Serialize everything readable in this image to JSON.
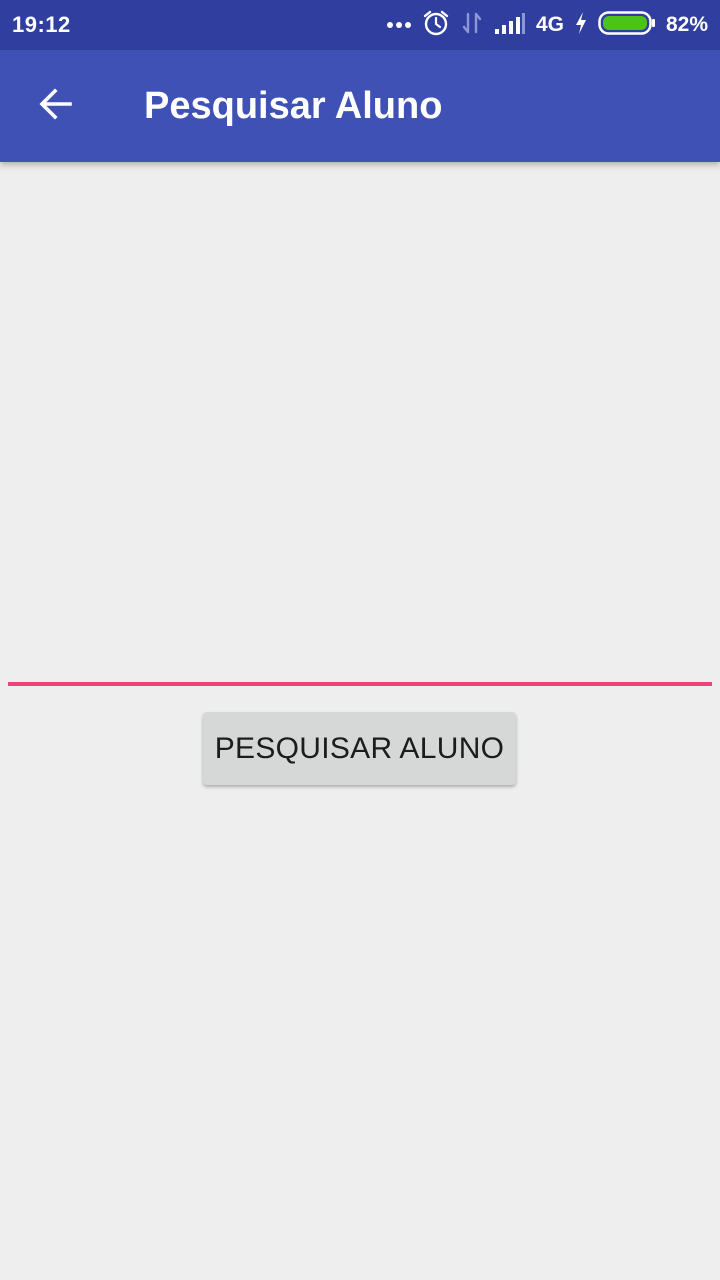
{
  "status_bar": {
    "time": "19:12",
    "network": "4G",
    "battery": "82%",
    "battery_level": 0.82,
    "icons": [
      "more-dots-icon",
      "alarm-icon",
      "data-arrows-icon",
      "signal-icon",
      "charging-icon",
      "battery-icon"
    ]
  },
  "app_bar": {
    "title": "Pesquisar Aluno",
    "back_icon": "arrow-back-icon"
  },
  "form": {
    "search_value": "",
    "search_button_label": "PESQUISAR ALUNO"
  },
  "colors": {
    "status_bar": "#303f9f",
    "app_bar": "#3f51b5",
    "accent": "#e94378",
    "background": "#eeeeee",
    "button": "#d6d7d7",
    "battery_fill": "#4cc417"
  }
}
